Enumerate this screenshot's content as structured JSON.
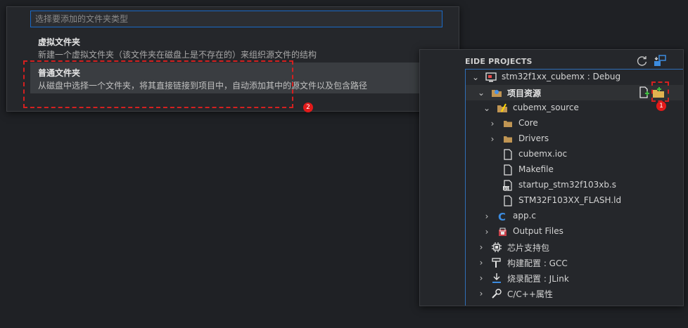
{
  "quick_pick": {
    "placeholder": "选择要添加的文件夹类型",
    "items": [
      {
        "label": "虚拟文件夹",
        "description": "新建一个虚拟文件夹（该文件夹在磁盘上是不存在的）来组织源文件的结构"
      },
      {
        "label": "普通文件夹",
        "description": "从磁盘中选择一个文件夹，将其直接链接到项目中，自动添加其中的源文件以及包含路径"
      }
    ]
  },
  "annotations": {
    "badge1": "1",
    "badge2": "2"
  },
  "panel": {
    "title": "EIDE PROJECTS",
    "refresh_icon": "refresh-icon",
    "switch_icon": "switch-project-icon",
    "tree": {
      "project": "stm32f1xx_cubemx : Debug",
      "project_resources": "项目资源",
      "cubemx_source": "cubemx_source",
      "core": "Core",
      "drivers": "Drivers",
      "file_ioc": "cubemx.ioc",
      "file_makefile": "Makefile",
      "file_startup": "startup_stm32f103xb.s",
      "file_ld": "STM32F103XX_FLASH.ld",
      "file_app": "app.c",
      "output_files": "Output Files",
      "chip_package": "芯片支持包",
      "build_config": "构建配置 : GCC",
      "flash_config": "烧录配置 : JLink",
      "cpp_props": "C/C++属性"
    }
  },
  "colors": {
    "background": "#1f2125",
    "accent_blue": "#1a6ac7",
    "annotation_red": "#d42020",
    "folder_tan": "#c09553"
  }
}
